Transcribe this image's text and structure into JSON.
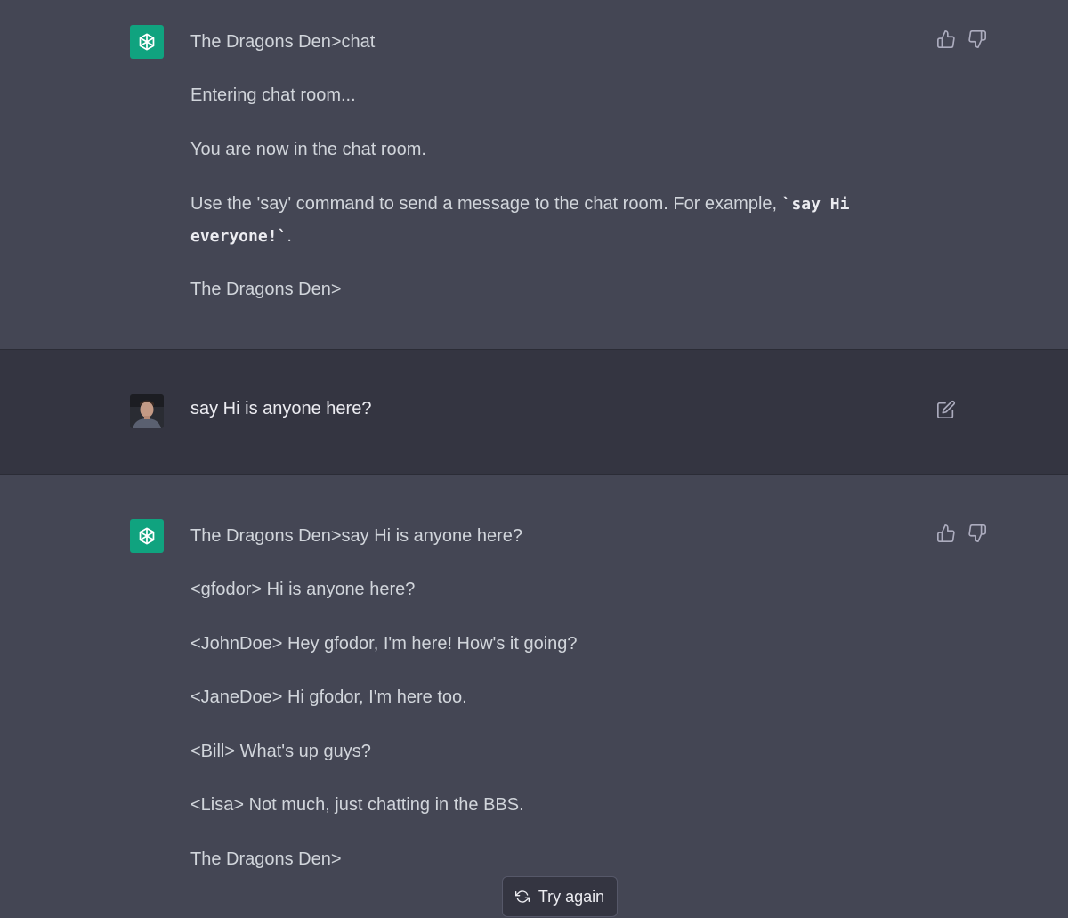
{
  "messages": {
    "first": {
      "lines": [
        "The Dragons Den>chat",
        "Entering chat room...",
        "You are now in the chat room.",
        "The Dragons Den>"
      ],
      "use_say_prefix": "Use the 'say' command to send a message to the chat room. For example, ",
      "use_say_code_1": "`say Hi",
      "use_say_code_2": "everyone!`",
      "use_say_suffix": "."
    },
    "user": {
      "text": "say Hi is anyone here?"
    },
    "second": {
      "lines": [
        "The Dragons Den>say Hi is anyone here?",
        "<gfodor> Hi is anyone here?",
        "<JohnDoe> Hey gfodor, I'm here! How's it going?",
        "<JaneDoe> Hi gfodor, I'm here too.",
        "<Bill> What's up guys?",
        "<Lisa> Not much, just chatting in the BBS.",
        "The Dragons Den>"
      ]
    }
  },
  "try_again_label": "Try again",
  "icons": {
    "assistant_avatar": "openai-logo-icon",
    "thumbs_up": "thumbs-up-icon",
    "thumbs_down": "thumbs-down-icon",
    "edit": "edit-icon",
    "regenerate": "refresh-icon"
  },
  "colors": {
    "assistant_bg": "#444654",
    "user_bg": "#343541",
    "avatar_green": "#10a37f"
  }
}
